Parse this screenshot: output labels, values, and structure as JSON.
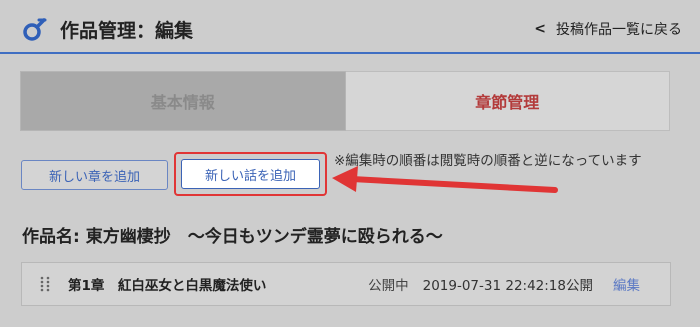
{
  "header": {
    "title": "作品管理：編集",
    "back_label": "投稿作品一覧に戻る",
    "accent_color": "#3f6ec2"
  },
  "tabs": [
    {
      "label": "基本情報",
      "active": false
    },
    {
      "label": "章節管理",
      "active": true
    }
  ],
  "actions": {
    "add_chapter_label": "新しい章を追加",
    "add_story_label": "新しい話を追加",
    "note": "※編集時の順番は閲覧時の順番と逆になっています"
  },
  "work": {
    "title": "作品名: 東方幽棲抄　～今日もツンデ霊夢に殴られる～"
  },
  "chapters": [
    {
      "name": "第1章　紅白巫女と白黒魔法使い",
      "status": "公開中",
      "timestamp": "2019-07-31 22:42:18公開",
      "edit_label": "編集"
    }
  ],
  "annotation": {
    "highlight_color": "#e03535",
    "arrow_target": "add_story_button"
  }
}
